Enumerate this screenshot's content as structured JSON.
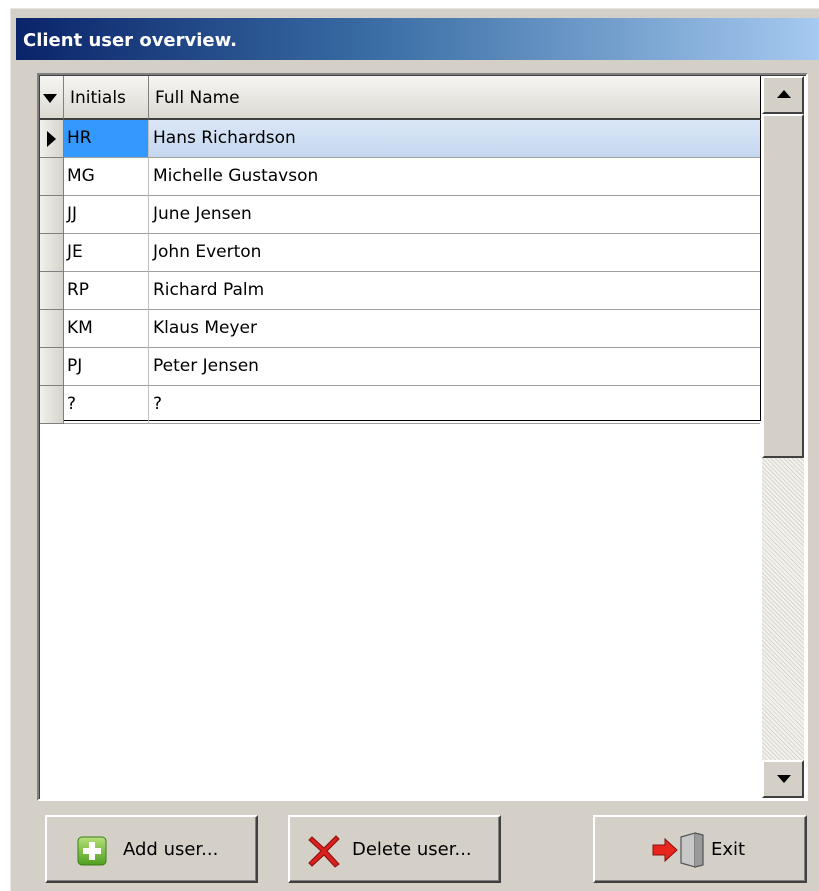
{
  "window": {
    "title": "Client user overview."
  },
  "grid": {
    "columns": {
      "initials": "Initials",
      "full_name": "Full Name"
    },
    "rows": [
      {
        "initials": "HR",
        "full_name": "Hans Richardson",
        "selected": true
      },
      {
        "initials": "MG",
        "full_name": "Michelle Gustavson"
      },
      {
        "initials": "JJ",
        "full_name": "June Jensen"
      },
      {
        "initials": "JE",
        "full_name": "John Everton"
      },
      {
        "initials": "RP",
        "full_name": "Richard Palm"
      },
      {
        "initials": "KM",
        "full_name": "Klaus Meyer"
      },
      {
        "initials": "PJ",
        "full_name": "Peter Jensen"
      },
      {
        "initials": "?",
        "full_name": "?"
      }
    ]
  },
  "buttons": {
    "add_label": "Add user...",
    "delete_label": "Delete user...",
    "exit_label": "Exit"
  },
  "icons": {
    "add": "plus-icon",
    "delete": "red-x-icon",
    "exit": "exit-door-icon"
  },
  "colors": {
    "title_gradient_start": "#0a246a",
    "title_gradient_end": "#a6caf0",
    "selection_cell": "#3399ff",
    "selection_row": "#c4d7ef",
    "window_face": "#d4d0c8"
  }
}
